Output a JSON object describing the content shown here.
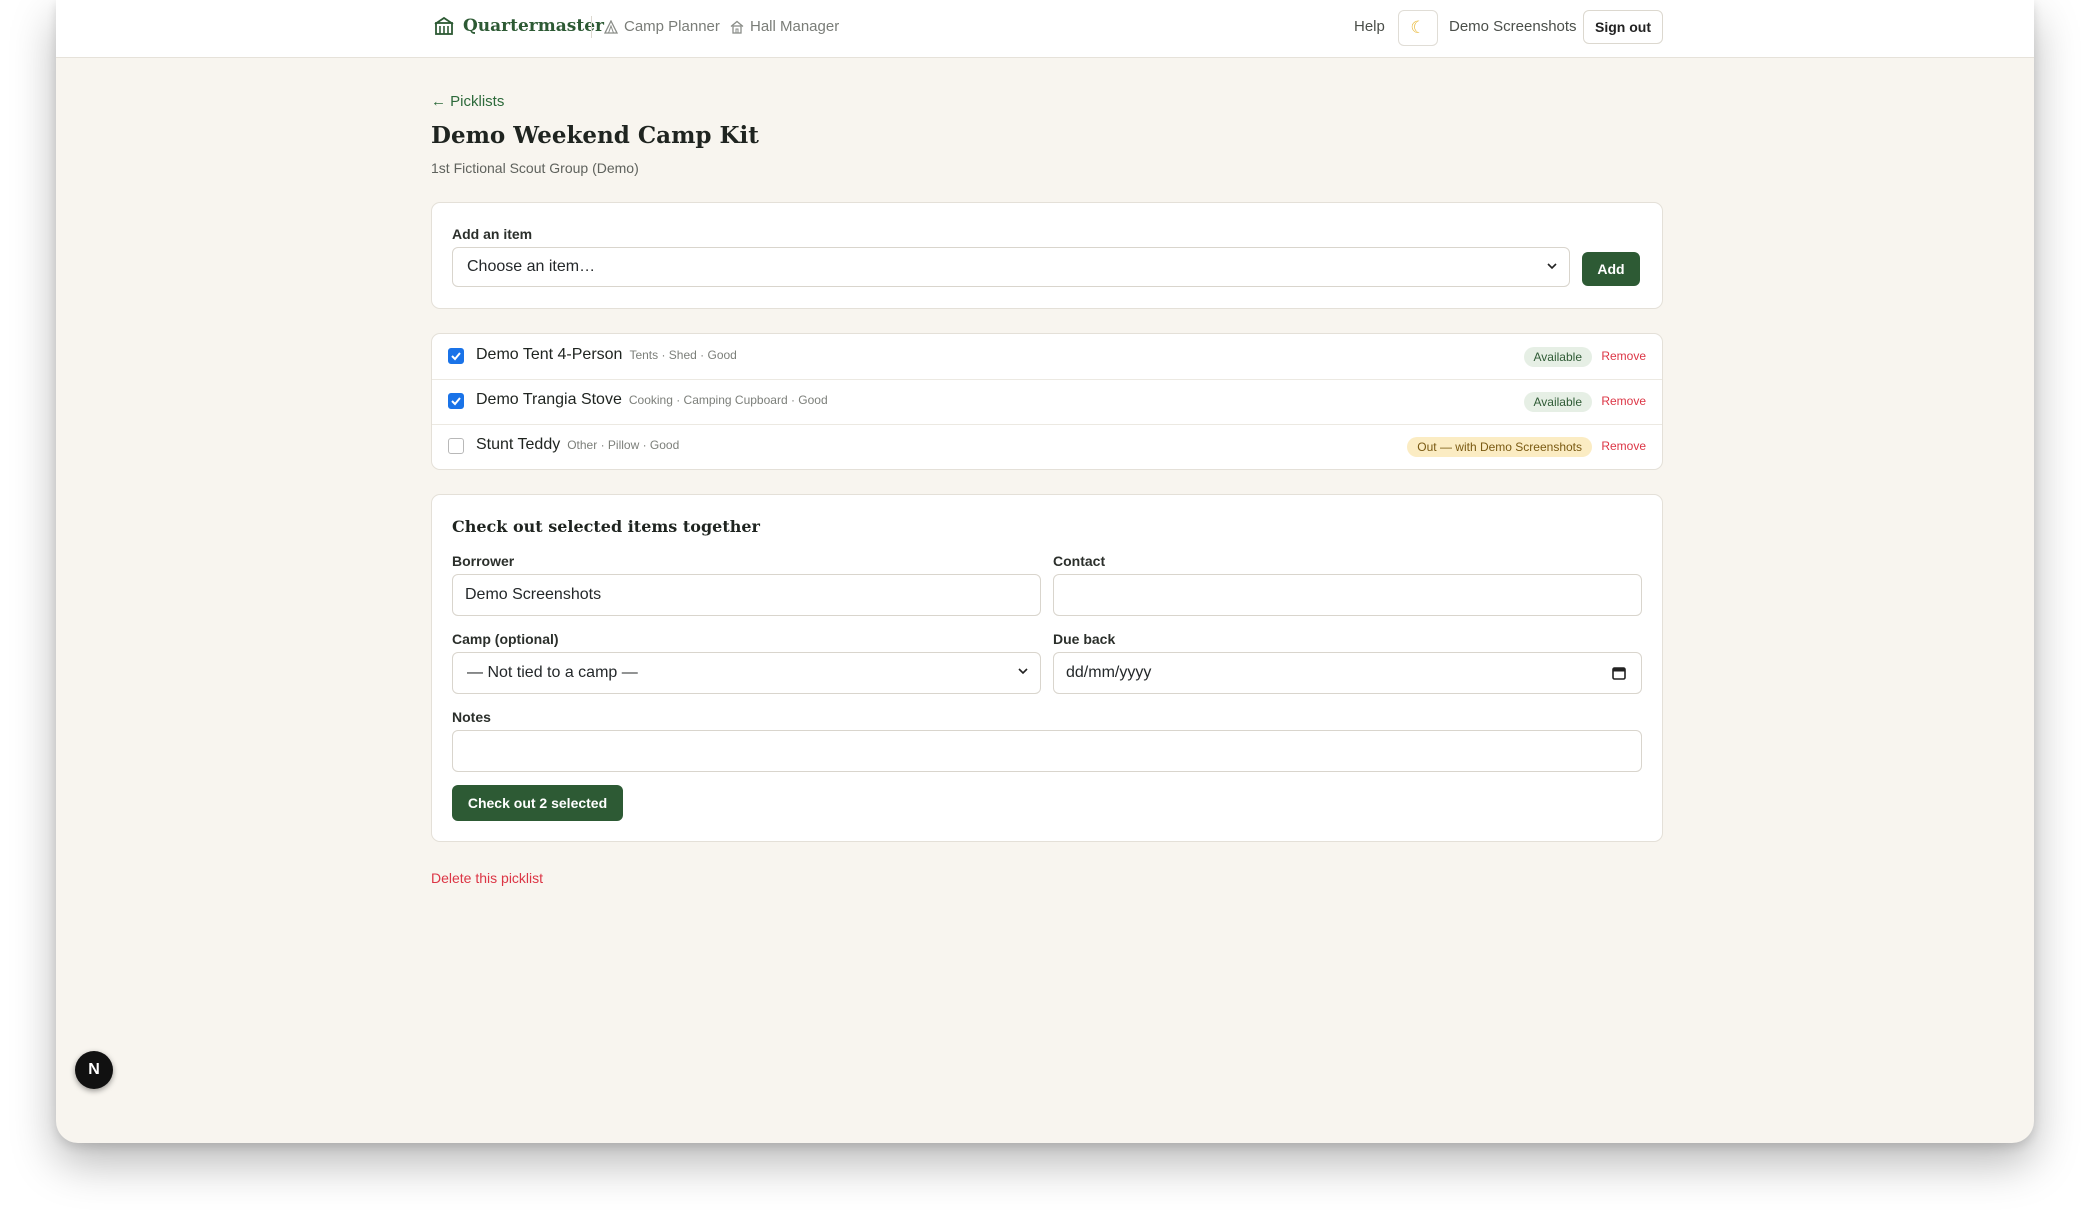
{
  "header": {
    "brand": "Quartermaster",
    "nav": [
      {
        "label": "Camp Planner",
        "icon": "tent-icon"
      },
      {
        "label": "Hall Manager",
        "icon": "house-icon"
      }
    ],
    "help_label": "Help",
    "theme_icon": "☾",
    "user_name": "Demo Screenshots",
    "signout_label": "Sign out"
  },
  "page": {
    "back_link": "← Picklists",
    "title": "Demo Weekend Camp Kit",
    "subtitle": "1st Fictional Scout Group (Demo)"
  },
  "add_item": {
    "label": "Add an item",
    "select_value": "Choose an item…",
    "button": "Add"
  },
  "items": [
    {
      "name": "Demo Tent 4-Person",
      "meta": "Tents · Shed · Good",
      "checked": true,
      "status": "Available",
      "status_type": "available",
      "remove": "Remove"
    },
    {
      "name": "Demo Trangia Stove",
      "meta": "Cooking · Camping Cupboard · Good",
      "checked": true,
      "status": "Available",
      "status_type": "available",
      "remove": "Remove"
    },
    {
      "name": "Stunt Teddy",
      "meta": "Other · Pillow · Good",
      "checked": false,
      "status": "Out — with Demo Screenshots",
      "status_type": "out",
      "remove": "Remove"
    }
  ],
  "checkout": {
    "title": "Check out selected items together",
    "borrower_label": "Borrower",
    "borrower_value": "Demo Screenshots",
    "contact_label": "Contact",
    "contact_value": "",
    "camp_label": "Camp (optional)",
    "camp_value": "— Not tied to a camp —",
    "due_label": "Due back",
    "due_placeholder": "dd/mm/yyyy",
    "notes_label": "Notes",
    "notes_value": "",
    "button": "Check out 2 selected"
  },
  "delete_link": "Delete this picklist",
  "dev_badge": "N",
  "colors": {
    "primary": "#2d5a34",
    "page_bg": "#f8f5ef",
    "danger": "#dc3545",
    "available_bg": "#e6efe5",
    "out_bg": "#fbecc3"
  }
}
